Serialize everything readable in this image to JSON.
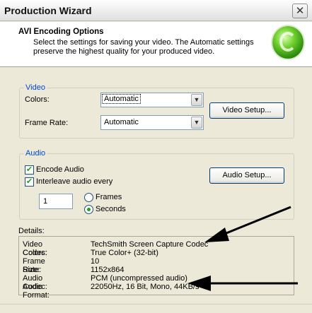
{
  "window": {
    "title": "Production Wizard",
    "close_glyph": "✕"
  },
  "header": {
    "title": "AVI Encoding Options",
    "description": "Select the settings for saving your video.  The Automatic settings preserve the highest quality for your produced video.",
    "logo_icon": "green-orb-logo"
  },
  "video": {
    "group_label": "Video",
    "colors_label": "Colors:",
    "colors_value": "Automatic",
    "frame_rate_label": "Frame Rate:",
    "frame_rate_value": "Automatic",
    "setup_button": "Video Setup..."
  },
  "audio": {
    "group_label": "Audio",
    "encode_audio_label": "Encode Audio",
    "encode_audio_checked": true,
    "interleave_label": "Interleave audio every",
    "interleave_checked": true,
    "interleave_value": "1",
    "frames_label": "Frames",
    "seconds_label": "Seconds",
    "selected_unit": "Seconds",
    "setup_button": "Audio Setup..."
  },
  "details": {
    "label": "Details:",
    "rows": [
      {
        "key": "Video Codec:",
        "value": "TechSmith Screen Capture Codec"
      },
      {
        "key": "Colors:",
        "value": "True Color+ (32-bit)"
      },
      {
        "key": "Frame Rate:",
        "value": "10"
      },
      {
        "key": "Size:",
        "value": "1152x864"
      },
      {
        "key": "Audio Codec:",
        "value": "PCM (uncompressed audio)"
      },
      {
        "key": "Audio Format:",
        "value": "22050Hz, 16 Bit, Mono, 44KB/s"
      }
    ]
  },
  "colors": {
    "dialog_bg": "#ece9d8",
    "group_label": "#0046d5",
    "check_green": "#21a121"
  },
  "annotations": {
    "arrow_icon": "black-arrow"
  }
}
